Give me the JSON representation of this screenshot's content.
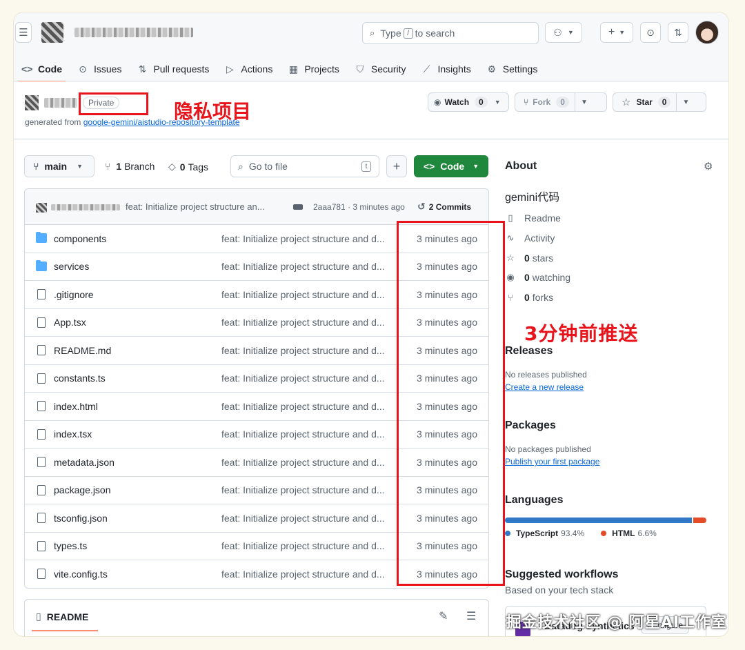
{
  "header": {
    "search_placeholder_pre": "Type",
    "search_key": "/",
    "search_placeholder_post": "to search"
  },
  "nav": {
    "tabs": [
      {
        "label": "Code",
        "icon": "code-icon"
      },
      {
        "label": "Issues",
        "icon": "issue-icon"
      },
      {
        "label": "Pull requests",
        "icon": "pull-request-icon"
      },
      {
        "label": "Actions",
        "icon": "play-icon"
      },
      {
        "label": "Projects",
        "icon": "table-icon"
      },
      {
        "label": "Security",
        "icon": "shield-icon"
      },
      {
        "label": "Insights",
        "icon": "graph-icon"
      },
      {
        "label": "Settings",
        "icon": "gear-icon"
      }
    ]
  },
  "repo": {
    "visibility": "Private",
    "generated_from_label": "generated from",
    "generated_from_link": "google-gemini/aistudio-repository-template",
    "annotation_private": "隐私项目",
    "watch_label": "Watch",
    "watch_count": "0",
    "fork_label": "Fork",
    "fork_count": "0",
    "star_label": "Star",
    "star_count": "0"
  },
  "toolbar": {
    "branch": "main",
    "branch_count": "1",
    "branch_label": "Branch",
    "tag_count": "0",
    "tag_label": "Tags",
    "goto_placeholder": "Go to file",
    "goto_key": "t",
    "add_label": "+",
    "code_label": "Code"
  },
  "commit": {
    "message": "feat: Initialize project structure an...",
    "hash": "2aaa781",
    "time": "· 3 minutes ago",
    "commits_label": "2 Commits"
  },
  "files": [
    {
      "name": "components",
      "type": "folder",
      "message": "feat: Initialize project structure and d...",
      "time": "3 minutes ago"
    },
    {
      "name": "services",
      "type": "folder",
      "message": "feat: Initialize project structure and d...",
      "time": "3 minutes ago"
    },
    {
      "name": ".gitignore",
      "type": "file",
      "message": "feat: Initialize project structure and d...",
      "time": "3 minutes ago"
    },
    {
      "name": "App.tsx",
      "type": "file",
      "message": "feat: Initialize project structure and d...",
      "time": "3 minutes ago"
    },
    {
      "name": "README.md",
      "type": "file",
      "message": "feat: Initialize project structure and d...",
      "time": "3 minutes ago"
    },
    {
      "name": "constants.ts",
      "type": "file",
      "message": "feat: Initialize project structure and d...",
      "time": "3 minutes ago"
    },
    {
      "name": "index.html",
      "type": "file",
      "message": "feat: Initialize project structure and d...",
      "time": "3 minutes ago"
    },
    {
      "name": "index.tsx",
      "type": "file",
      "message": "feat: Initialize project structure and d...",
      "time": "3 minutes ago"
    },
    {
      "name": "metadata.json",
      "type": "file",
      "message": "feat: Initialize project structure and d...",
      "time": "3 minutes ago"
    },
    {
      "name": "package.json",
      "type": "file",
      "message": "feat: Initialize project structure and d...",
      "time": "3 minutes ago"
    },
    {
      "name": "tsconfig.json",
      "type": "file",
      "message": "feat: Initialize project structure and d...",
      "time": "3 minutes ago"
    },
    {
      "name": "types.ts",
      "type": "file",
      "message": "feat: Initialize project structure and d...",
      "time": "3 minutes ago"
    },
    {
      "name": "vite.config.ts",
      "type": "file",
      "message": "feat: Initialize project structure and d...",
      "time": "3 minutes ago"
    }
  ],
  "about": {
    "title": "About",
    "description": "gemini代码",
    "items": [
      {
        "icon": "book-icon",
        "label": "Readme",
        "count": ""
      },
      {
        "icon": "pulse-icon",
        "label": "Activity",
        "count": ""
      },
      {
        "icon": "star-icon",
        "label": "stars",
        "count": "0"
      },
      {
        "icon": "eye-icon",
        "label": "watching",
        "count": "0"
      },
      {
        "icon": "fork-icon",
        "label": "forks",
        "count": "0"
      }
    ],
    "annotation_time": "3分钟前推送"
  },
  "releases": {
    "title": "Releases",
    "empty": "No releases published",
    "link": "Create a new release"
  },
  "packages": {
    "title": "Packages",
    "empty": "No packages published",
    "link": "Publish your first package"
  },
  "languages": {
    "title": "Languages",
    "items": [
      {
        "name": "TypeScript",
        "percent": "93.4%",
        "value": 93.4,
        "color": "#3178c6"
      },
      {
        "name": "HTML",
        "percent": "6.6%",
        "value": 6.6,
        "color": "#e34c26"
      }
    ]
  },
  "workflows": {
    "title": "Suggested workflows",
    "subtitle": "Based on your tech stack",
    "card_title": "Datadog Synthetics",
    "card_button": "Configure"
  },
  "readme": {
    "label": "README"
  },
  "watermark": "掘金技术社区 @ 阿星AI工作室"
}
